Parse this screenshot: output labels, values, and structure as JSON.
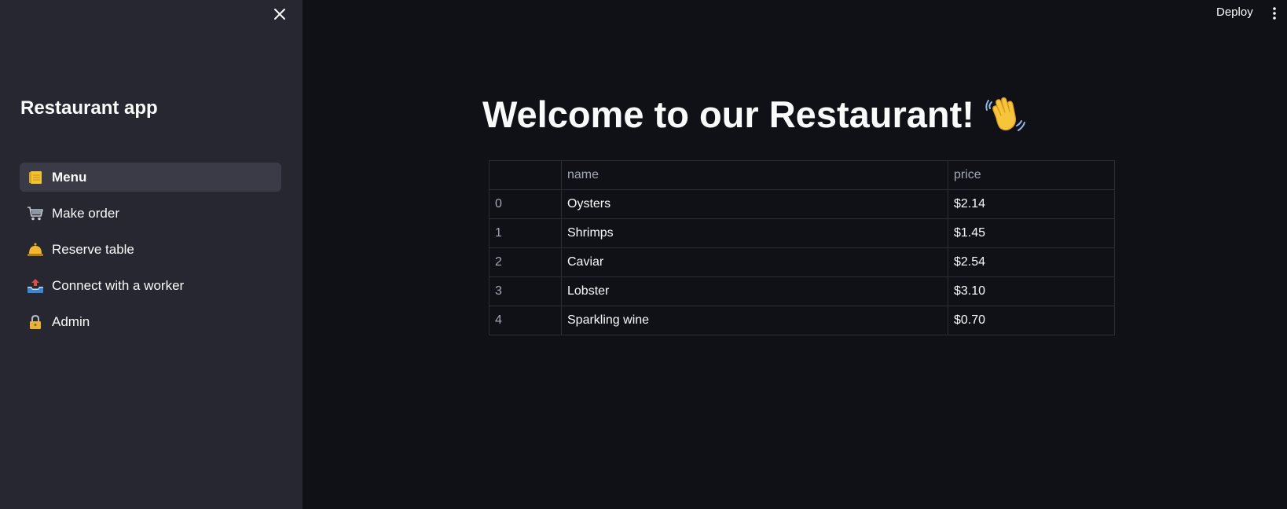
{
  "sidebar": {
    "title": "Restaurant app",
    "items": [
      {
        "label": "Menu",
        "icon": "notepad-icon",
        "active": true
      },
      {
        "label": "Make order",
        "icon": "cart-icon",
        "active": false
      },
      {
        "label": "Reserve table",
        "icon": "bell-icon",
        "active": false
      },
      {
        "label": "Connect with a worker",
        "icon": "outbox-tray-icon",
        "active": false
      },
      {
        "label": "Admin",
        "icon": "lock-icon",
        "active": false
      }
    ]
  },
  "header": {
    "deploy_label": "Deploy"
  },
  "main": {
    "title": "Welcome to our Restaurant!",
    "title_icon": "waving-hand-icon",
    "table": {
      "columns": [
        "",
        "name",
        "price"
      ],
      "rows": [
        {
          "index": "0",
          "name": "Oysters",
          "price": "$2.14"
        },
        {
          "index": "1",
          "name": "Shrimps",
          "price": "$1.45"
        },
        {
          "index": "2",
          "name": "Caviar",
          "price": "$2.54"
        },
        {
          "index": "3",
          "name": "Lobster",
          "price": "$3.10"
        },
        {
          "index": "4",
          "name": "Sparkling wine",
          "price": "$0.70"
        }
      ]
    }
  },
  "colors": {
    "background": "#0f1117",
    "sidebar": "#262730",
    "active_item": "#3a3b47",
    "text": "#fafafa",
    "muted_text": "#a3a8b8",
    "table_border": "#2a2c36"
  }
}
